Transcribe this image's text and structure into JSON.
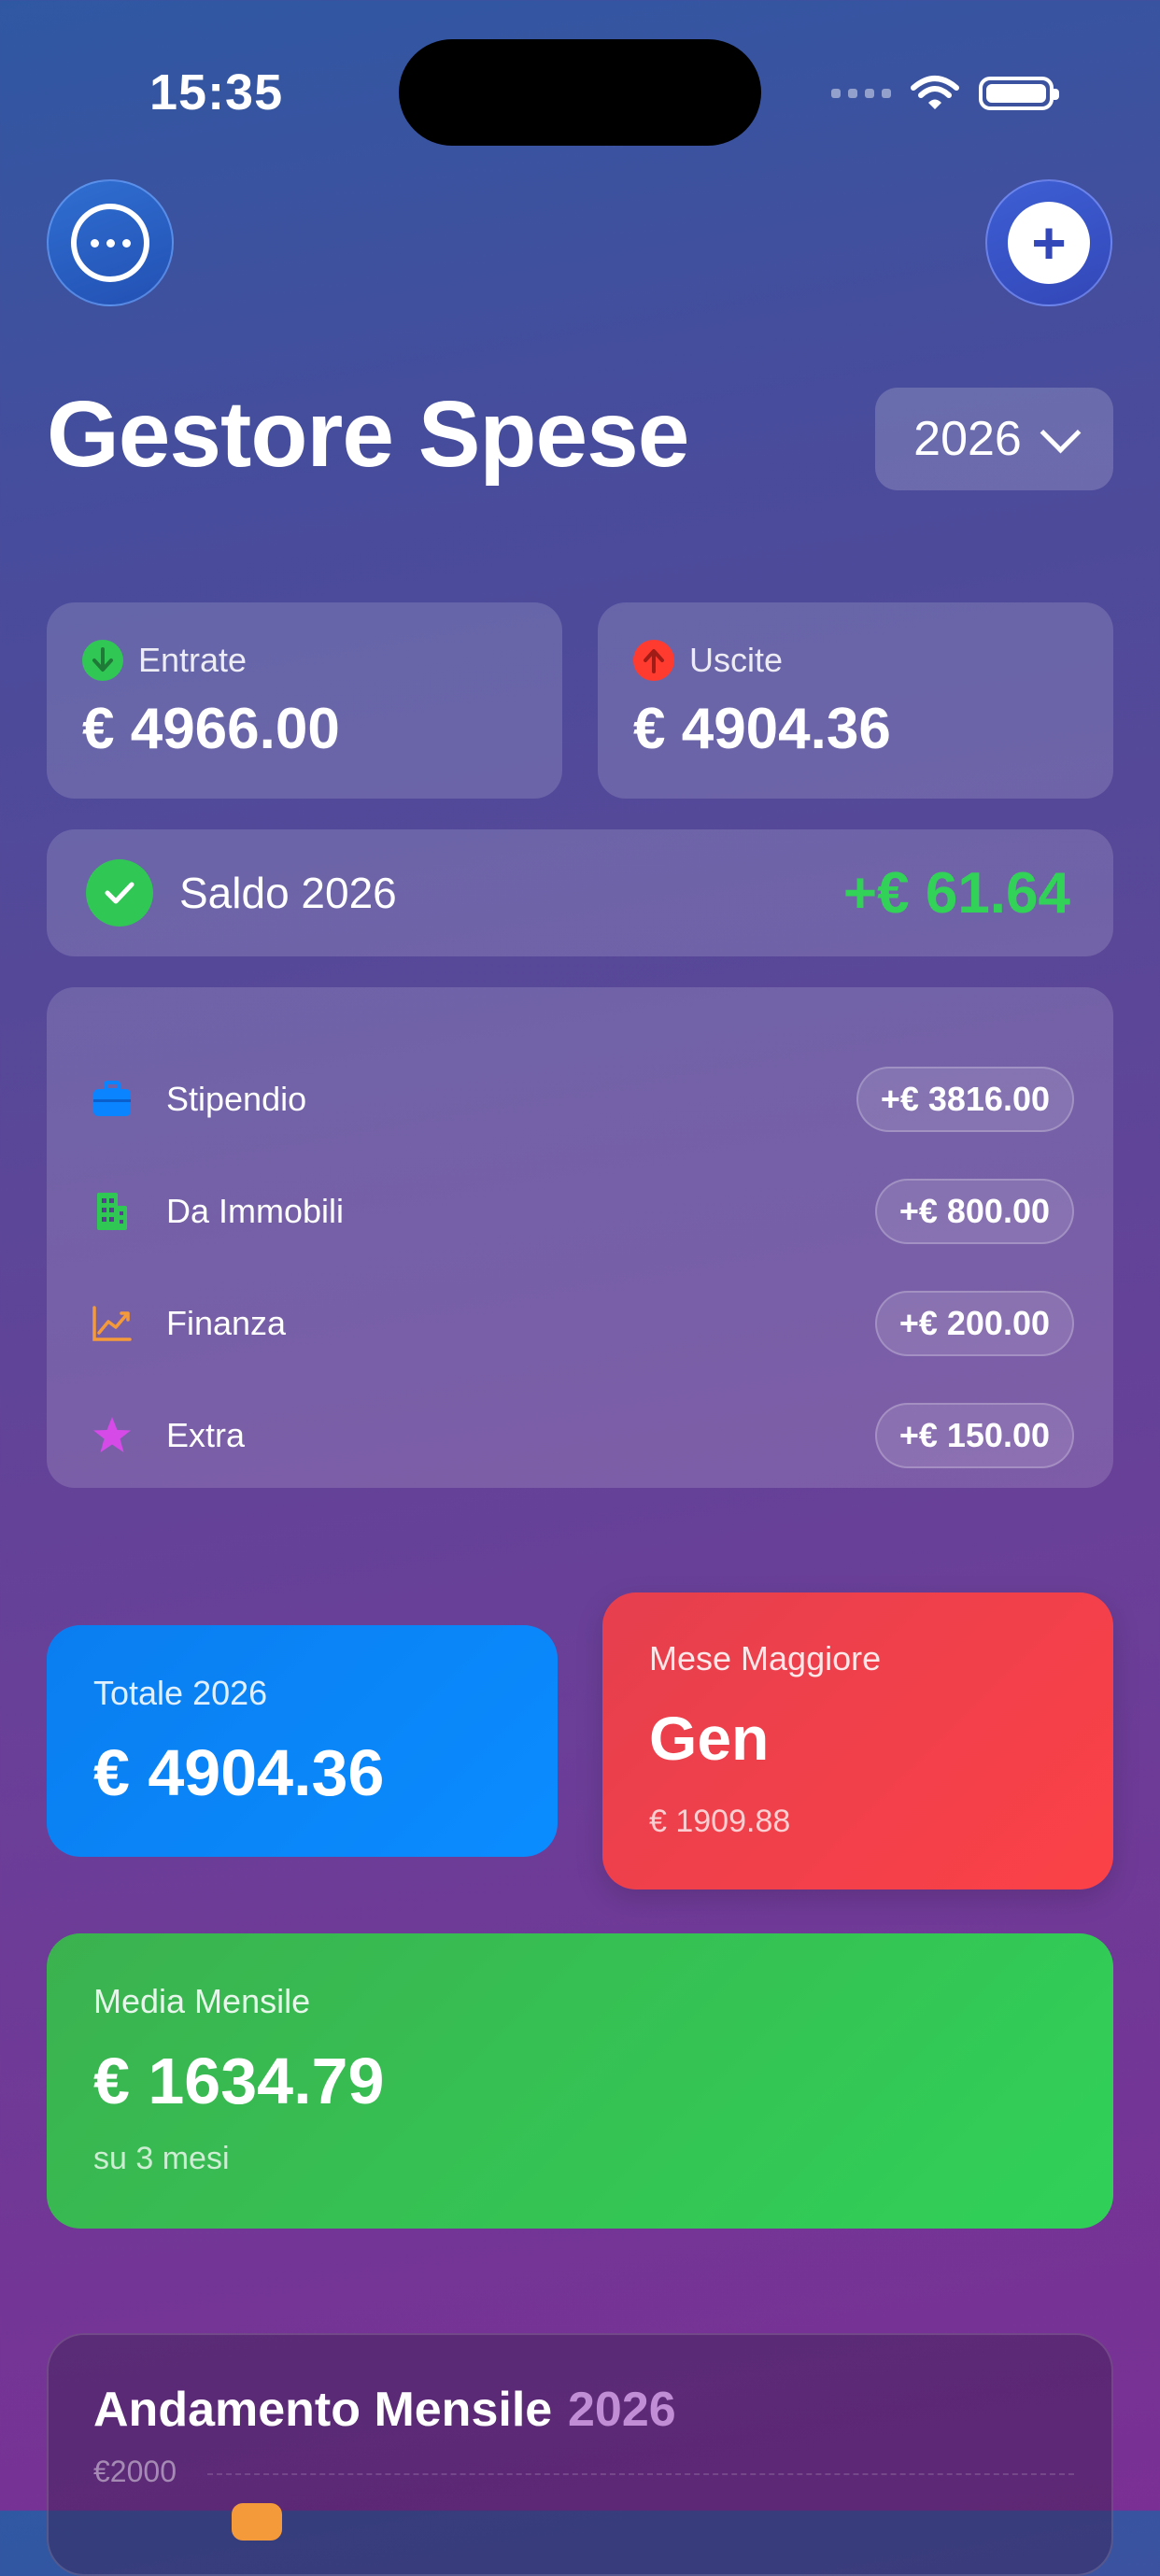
{
  "status_bar": {
    "time": "15:35"
  },
  "header": {
    "title": "Gestore Spese",
    "year_selector": "2026"
  },
  "summary": {
    "income": {
      "label": "Entrate",
      "value": "€ 4966.00",
      "color": "#30c755"
    },
    "expenses": {
      "label": "Uscite",
      "value": "€ 4904.36",
      "color": "#ff3b30"
    },
    "balance": {
      "label": "Saldo 2026",
      "value": "+€ 61.64",
      "color": "#32d158"
    }
  },
  "income_sources": [
    {
      "label": "Stipendio",
      "amount": "+€ 3816.00",
      "icon": "briefcase-icon",
      "color": "#0a84ff"
    },
    {
      "label": "Da Immobili",
      "amount": "+€ 800.00",
      "icon": "building-icon",
      "color": "#30c755"
    },
    {
      "label": "Finanza",
      "amount": "+€ 200.00",
      "icon": "chart-line-icon",
      "color": "#f59a3a"
    },
    {
      "label": "Extra",
      "amount": "+€ 150.00",
      "icon": "star-icon",
      "color": "#d64ae8"
    }
  ],
  "stats": {
    "total": {
      "label": "Totale 2026",
      "value": "€ 4904.36",
      "color": "#0a84ff"
    },
    "max_month": {
      "label": "Mese Maggiore",
      "value": "Gen",
      "sub": "€ 1909.88",
      "color": "#f2404b"
    },
    "average": {
      "label": "Media Mensile",
      "value": "€ 1634.79",
      "sub": "su 3 mesi",
      "color": "#34c759"
    }
  },
  "trend": {
    "title": "Andamento Mensile",
    "year": "2026",
    "tick_top": "€2000"
  }
}
